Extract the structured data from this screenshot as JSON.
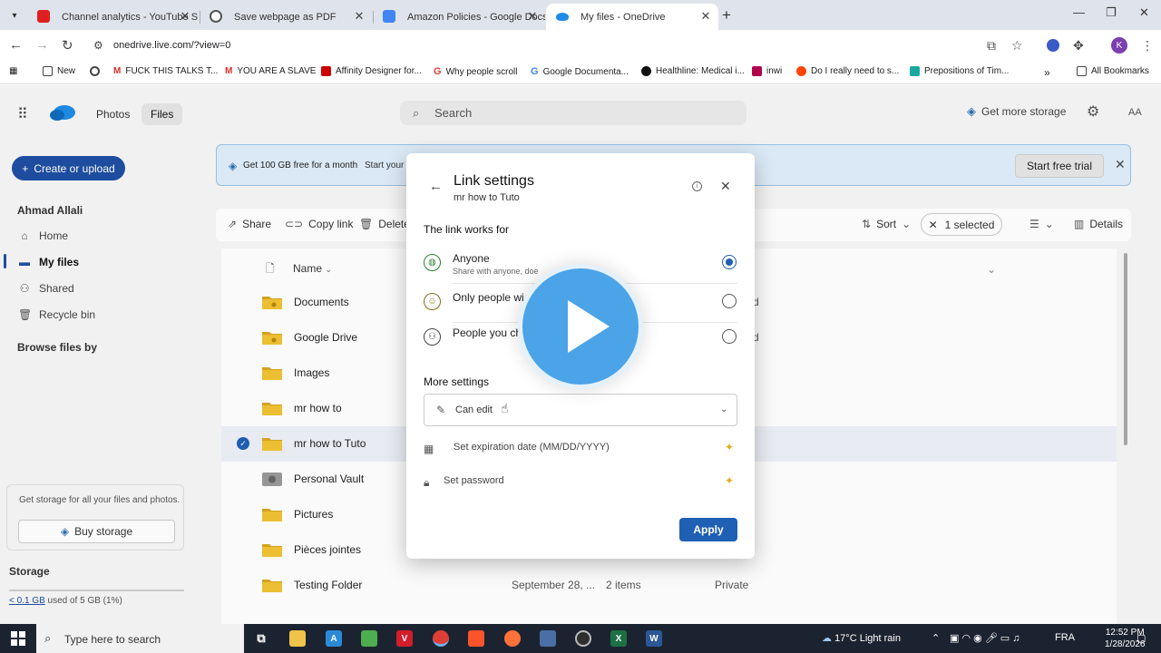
{
  "browser": {
    "tabs": [
      {
        "title": "Channel analytics - YouTube St",
        "icon_color": "#e02020"
      },
      {
        "title": "Save webpage as PDF",
        "icon_color": "#555555"
      },
      {
        "title": "Amazon Policies - Google Docs",
        "icon_color": "#4285f4"
      },
      {
        "title": "My files - OneDrive",
        "icon_color": "#1f8ce6"
      }
    ],
    "url": "onedrive.live.com/?view=0",
    "profile_initial": "K",
    "bookmarks": [
      {
        "label": "New",
        "icon_color": "#444444"
      },
      {
        "label": "",
        "icon_color": "#444444"
      },
      {
        "label": "FUCK THIS TALKS T...",
        "icon_color": "#d93025"
      },
      {
        "label": "YOU ARE A SLAVE",
        "icon_color": "#d93025"
      },
      {
        "label": "Affinity Designer for...",
        "icon_color": "#cc0000"
      },
      {
        "label": "Why people scroll",
        "icon_color": "#e53935"
      },
      {
        "label": "Google Documenta...",
        "icon_color": "#4285f4"
      },
      {
        "label": "Healthline: Medical i...",
        "icon_color": "#111111"
      },
      {
        "label": "inwi",
        "icon_color": "#b0004c"
      },
      {
        "label": "Do I really need to s...",
        "icon_color": "#ff4500"
      },
      {
        "label": "Prepositions of Tim...",
        "icon_color": "#19a8a0"
      }
    ],
    "all_bookmarks": "All Bookmarks"
  },
  "onedrive": {
    "tabs": {
      "photos": "Photos",
      "files": "Files"
    },
    "search_placeholder": "Search",
    "get_more_storage": "Get more storage",
    "avatar": "AA",
    "create_label": "Create or upload",
    "user_name": "Ahmad Allali",
    "nav": {
      "home": "Home",
      "my_files": "My files",
      "shared": "Shared",
      "recycle": "Recycle bin",
      "browse_by": "Browse files by"
    },
    "storage_card_text": "Get storage for all your files and photos.",
    "buy_storage": "Buy storage",
    "storage_heading": "Storage",
    "storage_used_amount": "< 0.1 GB",
    "storage_used_rest": "used of 5 GB (1%)",
    "promo": {
      "text": "Get 100 GB free for a month",
      "text2": "Start your 1",
      "button": "Start free trial"
    },
    "commands": {
      "share": "Share",
      "copy_link": "Copy link",
      "delete": "Delete",
      "sort": "Sort",
      "selected": "1 selected",
      "details": "Details"
    },
    "column_name": "Name",
    "files": [
      {
        "name": "Documents",
        "date": "",
        "items": "",
        "sharing": "",
        "type": "shared-folder",
        "peek": "d"
      },
      {
        "name": "Google Drive",
        "date": "",
        "items": "",
        "sharing": "",
        "type": "shared-folder",
        "peek": "d"
      },
      {
        "name": "Images",
        "date": "",
        "items": "",
        "sharing": "",
        "type": "folder",
        "peek": ""
      },
      {
        "name": "mr how to",
        "date": "",
        "items": "",
        "sharing": "",
        "type": "folder",
        "peek": ""
      },
      {
        "name": "mr how to Tuto",
        "date": "",
        "items": "",
        "sharing": "",
        "type": "folder",
        "peek": ""
      },
      {
        "name": "Personal Vault",
        "date": "",
        "items": "",
        "sharing": "",
        "type": "vault",
        "peek": ""
      },
      {
        "name": "Pictures",
        "date": "",
        "items": "",
        "sharing": "",
        "type": "folder",
        "peek": ""
      },
      {
        "name": "Pièces jointes",
        "date": "",
        "items": "",
        "sharing": "",
        "type": "folder",
        "peek": ""
      },
      {
        "name": "Testing Folder",
        "date": "September 28, ...",
        "items": "2 items",
        "sharing": "Private",
        "type": "folder",
        "peek": ""
      }
    ]
  },
  "modal": {
    "title": "Link settings",
    "subtitle": "mr how to Tuto",
    "works_for": "The link works for",
    "options": [
      {
        "title": "Anyone",
        "subtitle": "Share with anyone, doe",
        "selected": true,
        "color": "#2e7d32"
      },
      {
        "title": "Only people wi",
        "subtitle": "",
        "selected": false,
        "color": "#8a6d1a"
      },
      {
        "title": "People you ch",
        "subtitle": "",
        "selected": false,
        "color": "#444444"
      }
    ],
    "more_settings": "More settings",
    "permission": "Can edit",
    "expiration": "Set expiration date (MM/DD/YYYY)",
    "password": "Set password",
    "apply": "Apply"
  },
  "taskbar": {
    "search_placeholder": "Type here to search",
    "weather": "17°C  Light rain",
    "language": "FRA",
    "time": "12:52 PM",
    "date": "1/28/2026"
  }
}
